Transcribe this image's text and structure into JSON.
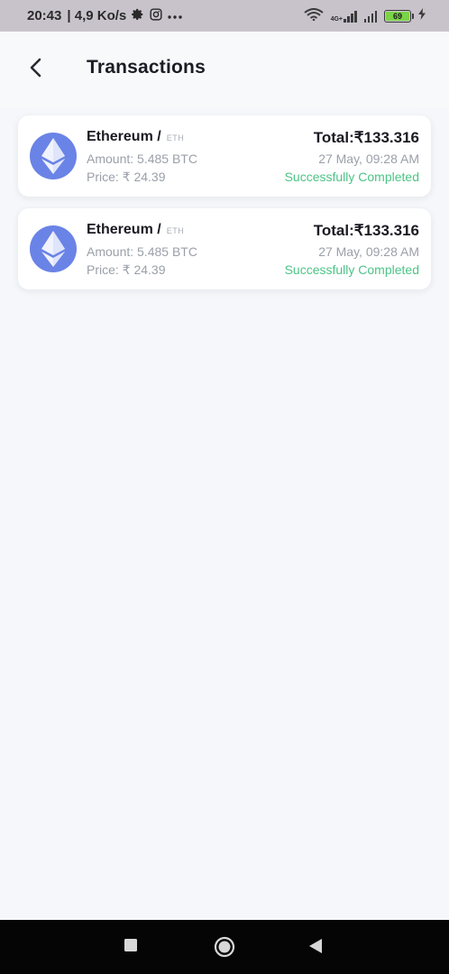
{
  "status_bar": {
    "time": "20:43",
    "speed": "| 4,9 Ko/s",
    "network_tag": "4G+",
    "battery": "69"
  },
  "header": {
    "title": "Transactions"
  },
  "transactions": [
    {
      "name": "Ethereum /",
      "symbol": "ETH",
      "amount": "Amount: 5.485 BTC",
      "price": "Price: ₹ 24.39",
      "total": "Total:₹133.316",
      "date": "27 May, 09:28 AM",
      "status": "Successfully Completed"
    },
    {
      "name": "Ethereum /",
      "symbol": "ETH",
      "amount": "Amount: 5.485 BTC",
      "price": "Price: ₹ 24.39",
      "total": "Total:₹133.316",
      "date": "27 May, 09:28 AM",
      "status": "Successfully Completed"
    }
  ],
  "colors": {
    "coin_bg": "#6a83e6",
    "status_success": "#4cc486",
    "background": "#f5f7fa"
  },
  "icons": {
    "back": "chevron-left-icon",
    "coin": "ethereum-icon",
    "nav_recent": "square-icon",
    "nav_home": "circle-icon",
    "nav_back": "triangle-back-icon"
  }
}
